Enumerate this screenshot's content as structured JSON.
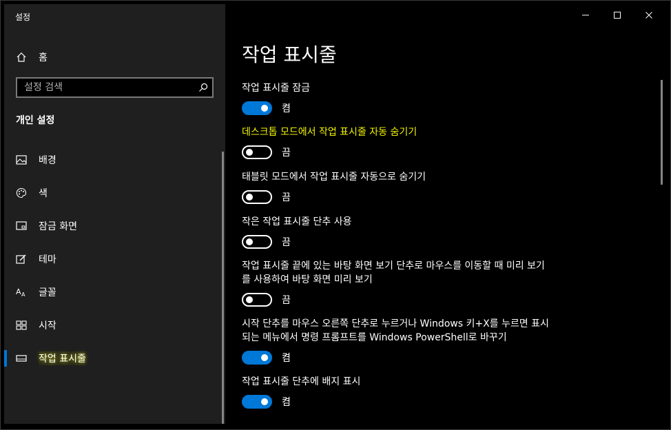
{
  "window": {
    "app_title": "설정"
  },
  "sidebar": {
    "home_label": "홈",
    "search_placeholder": "설정 검색",
    "section_title": "개인 설정",
    "items": [
      {
        "label": "배경",
        "icon": "picture-icon"
      },
      {
        "label": "색",
        "icon": "palette-icon"
      },
      {
        "label": "잠금 화면",
        "icon": "lock-screen-icon"
      },
      {
        "label": "테마",
        "icon": "theme-icon"
      },
      {
        "label": "글꼴",
        "icon": "font-icon"
      },
      {
        "label": "시작",
        "icon": "start-icon"
      },
      {
        "label": "작업 표시줄",
        "icon": "taskbar-icon",
        "selected": true
      }
    ]
  },
  "main": {
    "title": "작업 표시줄",
    "settings": [
      {
        "desc": "작업 표시줄 잠금",
        "on": true,
        "state": "켬"
      },
      {
        "desc": "데스크톱 모드에서 작업 표시줄 자동 숨기기",
        "on": false,
        "state": "끔",
        "highlight": true
      },
      {
        "desc": "태블릿 모드에서 작업 표시줄 자동으로 숨기기",
        "on": false,
        "state": "끔"
      },
      {
        "desc": "작은 작업 표시줄 단추 사용",
        "on": false,
        "state": "끔"
      },
      {
        "desc": "작업 표시줄 끝에 있는 바탕 화면 보기 단추로 마우스를 이동할 때 미리 보기를 사용하여 바탕 화면 미리 보기",
        "on": false,
        "state": "끔"
      },
      {
        "desc": "시작 단추를 마우스 오른쪽 단추로 누르거나 Windows 키+X를 누르면 표시되는 메뉴에서 명령 프롬프트를 Windows PowerShell로 바꾸기",
        "on": true,
        "state": "켬"
      },
      {
        "desc": "작업 표시줄 단추에 배지 표시",
        "on": true,
        "state": "켬"
      }
    ]
  },
  "colors": {
    "accent": "#0078d7",
    "highlight_text": "#f3f300",
    "sidebar_bg": "#1f1f1f"
  }
}
